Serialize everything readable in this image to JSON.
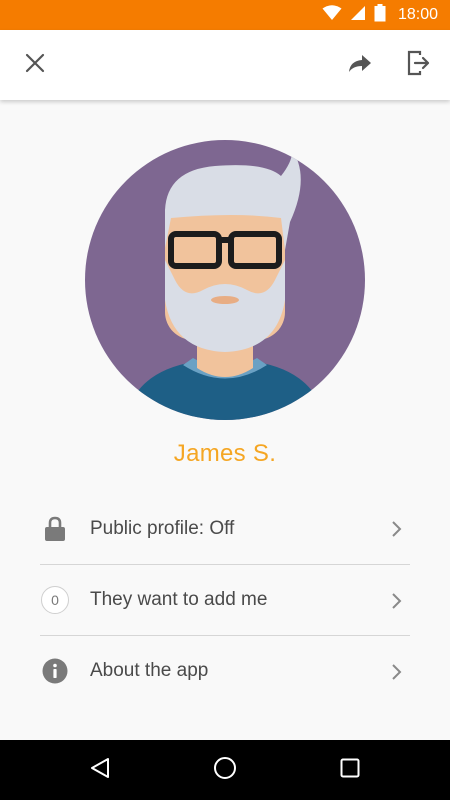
{
  "status_bar": {
    "time": "18:00",
    "icons": [
      "wifi-icon",
      "signal-icon",
      "battery-icon"
    ],
    "background": "#f57c00"
  },
  "app_bar": {
    "icons": [
      "close-icon",
      "share-icon",
      "logout-icon"
    ]
  },
  "profile": {
    "name": "James S.",
    "name_color": "#f5a623",
    "avatar_background": "#7e6791"
  },
  "menu": {
    "items": [
      {
        "label": "Public profile: Off",
        "icon": "lock-icon"
      },
      {
        "label": "They want to add me",
        "icon": "count-badge",
        "count": "0"
      },
      {
        "label": "About the app",
        "icon": "info-icon"
      }
    ]
  },
  "nav_bar": {
    "icons": [
      "back-icon",
      "home-icon",
      "recents-icon"
    ]
  }
}
